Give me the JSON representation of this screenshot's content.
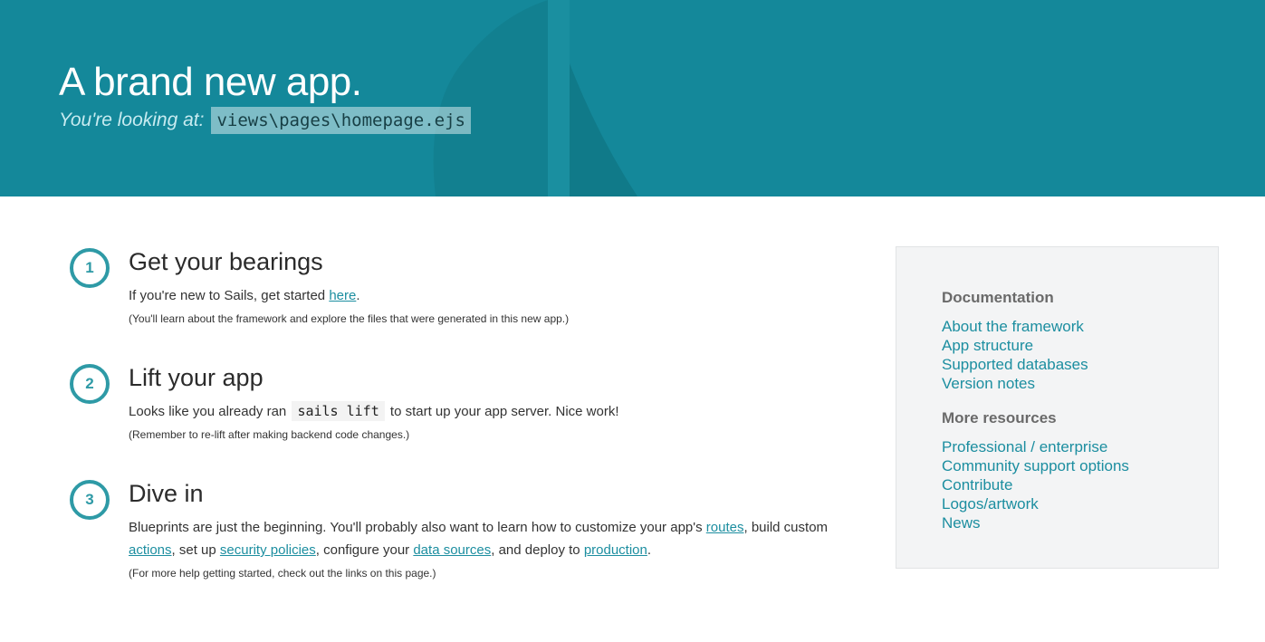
{
  "hero": {
    "title": "A brand new app.",
    "subtitle_label": "You're looking at:",
    "file_path": "views\\pages\\homepage.ejs"
  },
  "steps": [
    {
      "number": "1",
      "title": "Get your bearings",
      "text_before": "If you're new to Sails, get started ",
      "link": "here",
      "text_after": ".",
      "note": "(You'll learn about the framework and explore the files that were generated in this new app.)"
    },
    {
      "number": "2",
      "title": "Lift your app",
      "text_before": "Looks like you already ran ",
      "code": "sails lift",
      "text_after": " to start up your app server. Nice work!",
      "note": "(Remember to re-lift after making backend code changes.)"
    },
    {
      "number": "3",
      "title": "Dive in",
      "text_1": "Blueprints are just the beginning. You'll probably also want to learn how to customize your app's ",
      "link_routes": "routes",
      "text_2": ", build custom ",
      "link_actions": "actions",
      "text_3": ", set up ",
      "link_security": "security policies",
      "text_4": ", configure your ",
      "link_datasources": "data sources",
      "text_5": ", and deploy to ",
      "link_production": "production",
      "text_6": ".",
      "note": "(For more help getting started, check out the links on this page.)"
    }
  ],
  "sidebar": {
    "documentation_heading": "Documentation",
    "documentation_links": [
      "About the framework",
      "App structure",
      "Supported databases",
      "Version notes"
    ],
    "resources_heading": "More resources",
    "resources_links": [
      "Professional / enterprise",
      "Community support options",
      "Contribute",
      "Logos/artwork",
      "News"
    ]
  },
  "colors": {
    "hero_bg": "#14889a",
    "accent": "#1c8ea0",
    "step_circle": "#2e9aa6"
  }
}
